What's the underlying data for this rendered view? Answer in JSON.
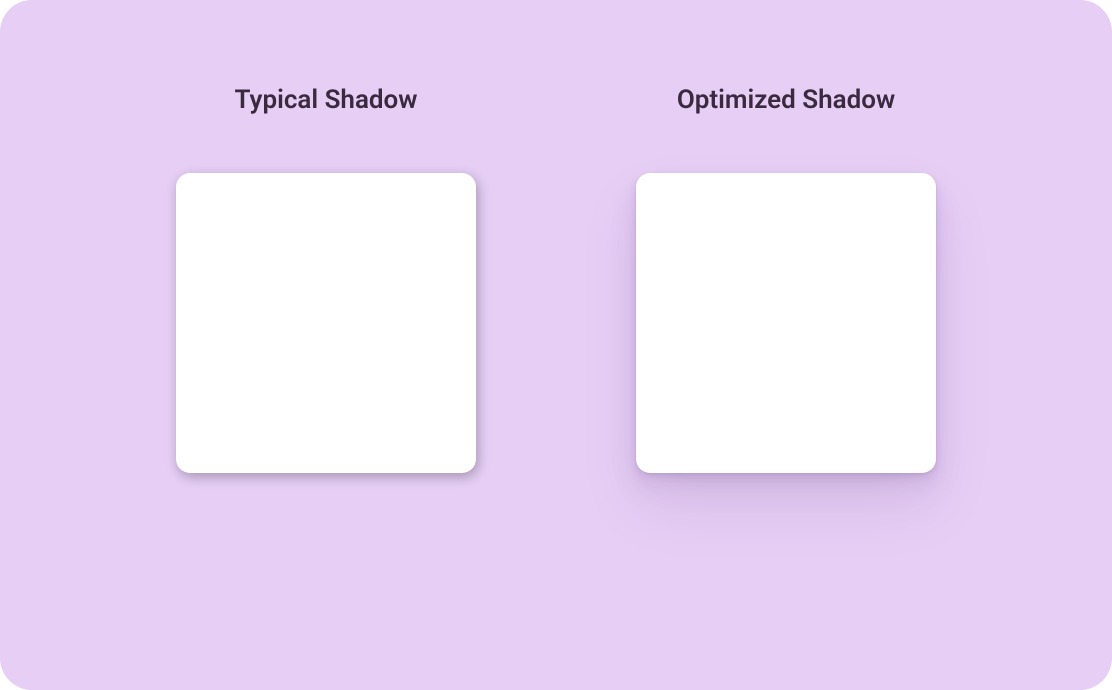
{
  "examples": [
    {
      "label": "Typical Shadow"
    },
    {
      "label": "Optimized Shadow"
    }
  ],
  "colors": {
    "background": "#E6CEF5",
    "box": "#FFFFFF",
    "text": "#3B2A3F"
  }
}
